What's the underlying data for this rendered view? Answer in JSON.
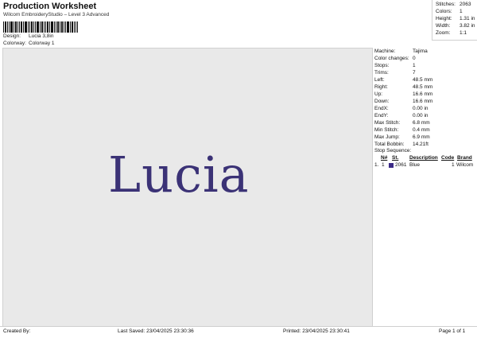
{
  "header": {
    "title": "Production Worksheet",
    "subtitle": "Wilcom EmbroideryStudio – Level 3 Advanced",
    "design_label": "Design:",
    "design_value": "Lucia 3,8in",
    "colorway_label": "Colorway:",
    "colorway_value": "Colorway 1"
  },
  "stats": [
    {
      "label": "Stitches:",
      "value": "2063"
    },
    {
      "label": "Colors:",
      "value": "1"
    },
    {
      "label": "Height:",
      "value": "1.31 in"
    },
    {
      "label": "Width:",
      "value": "3.82 in"
    },
    {
      "label": "Zoom:",
      "value": "1:1"
    }
  ],
  "design": {
    "text": "Lucia",
    "color": "#3b3276",
    "canvas_color": "#e9e9e9"
  },
  "machine_info": [
    {
      "label": "Machine:",
      "value": "Tajima"
    },
    {
      "label": "Color changes:",
      "value": "0"
    },
    {
      "label": "Stops:",
      "value": "1"
    },
    {
      "label": "Trims:",
      "value": "7"
    },
    {
      "label": "Left:",
      "value": "48.5 mm"
    },
    {
      "label": "Right:",
      "value": "48.5 mm"
    },
    {
      "label": "Up:",
      "value": "16.6 mm"
    },
    {
      "label": "Down:",
      "value": "16.6 mm"
    },
    {
      "label": "EndX:",
      "value": "0.00 in"
    },
    {
      "label": "EndY:",
      "value": "0.00 in"
    },
    {
      "label": "Max Stitch:",
      "value": "6.8 mm"
    },
    {
      "label": "Min Stitch:",
      "value": "0.4 mm"
    },
    {
      "label": "Max Jump:",
      "value": "6.9 mm"
    },
    {
      "label": "Total Bobbin:",
      "value": "14.21ft"
    }
  ],
  "stop_sequence": {
    "title": "Stop Sequence:",
    "headers": [
      "N#",
      "St.",
      "Description",
      "Code",
      "Brand"
    ],
    "rows": [
      {
        "stop": "1.",
        "n": "1",
        "st": "2061",
        "description": "Blue",
        "code": "1",
        "brand": "Wilcom",
        "color": "#3b2a86"
      }
    ]
  },
  "footer": {
    "created_by": "Created By:",
    "last_saved": "Last Saved: 23/04/2025 23:30:36",
    "printed": "Printed: 23/04/2025 23:30:41",
    "page": "Page 1 of 1"
  }
}
